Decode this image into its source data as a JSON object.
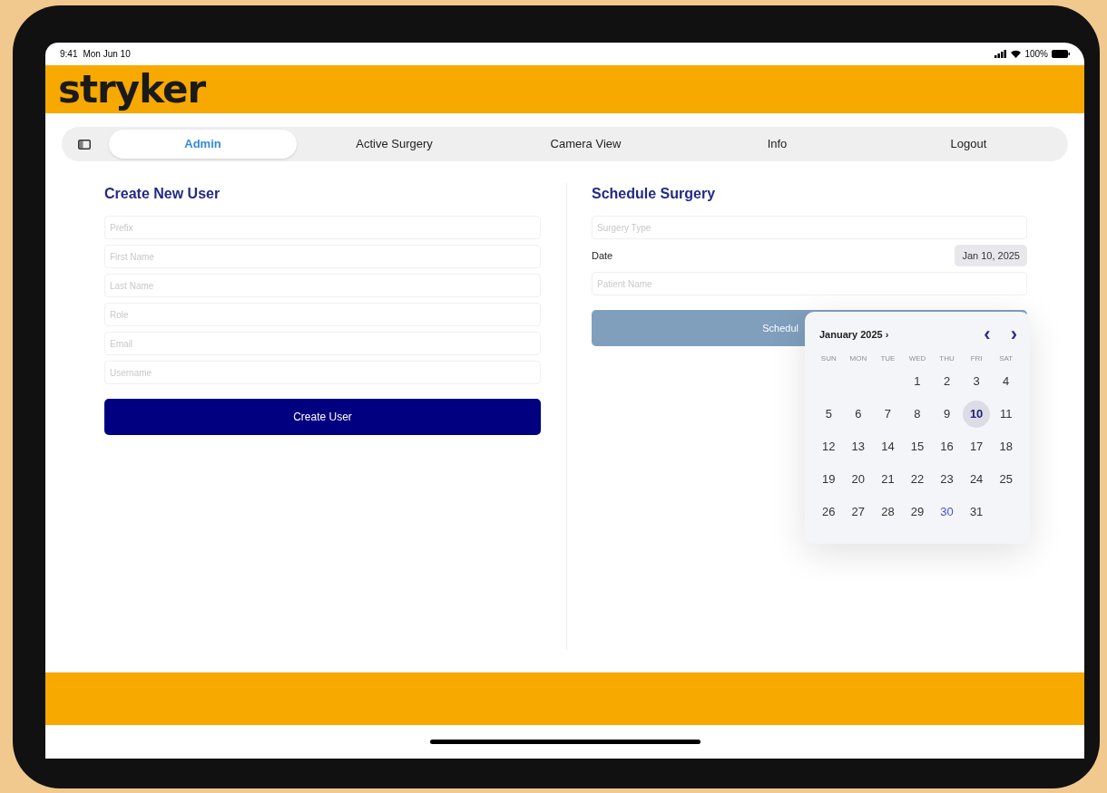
{
  "status_bar": {
    "time": "9:41",
    "date": "Mon Jun 10",
    "battery": "100%"
  },
  "header": {
    "logo": "stryker"
  },
  "tabs": [
    {
      "label": "Admin",
      "selected": true
    },
    {
      "label": "Active Surgery",
      "selected": false
    },
    {
      "label": "Camera View",
      "selected": false
    },
    {
      "label": "Info",
      "selected": false
    },
    {
      "label": "Logout",
      "selected": false
    }
  ],
  "create_user": {
    "title": "Create New User",
    "fields": [
      {
        "placeholder": "Prefix"
      },
      {
        "placeholder": "First Name"
      },
      {
        "placeholder": "Last Name"
      },
      {
        "placeholder": "Role"
      },
      {
        "placeholder": "Email"
      },
      {
        "placeholder": "Username"
      }
    ],
    "button": "Create User"
  },
  "schedule_surgery": {
    "title": "Schedule Surgery",
    "surgery_type": {
      "placeholder": "Surgery Type"
    },
    "date_label": "Date",
    "date_value": "Jan 10, 2025",
    "patient_name": {
      "placeholder": "Patient Name"
    },
    "button": "Schedul"
  },
  "date_picker": {
    "month": "January 2025",
    "month_caret": "›",
    "prev": "‹",
    "next": "›",
    "weekdays": [
      "SUN",
      "MON",
      "TUE",
      "WED",
      "THU",
      "FRI",
      "SAT"
    ],
    "days": [
      {
        "label": "1",
        "selected": false,
        "today": false
      },
      {
        "label": "2",
        "selected": false,
        "today": false
      },
      {
        "label": "3",
        "selected": false,
        "today": false
      },
      {
        "label": "4",
        "selected": false,
        "today": false
      },
      {
        "label": "5",
        "selected": false,
        "today": false
      },
      {
        "label": "6",
        "selected": false,
        "today": false
      },
      {
        "label": "7",
        "selected": false,
        "today": false
      },
      {
        "label": "8",
        "selected": false,
        "today": false
      },
      {
        "label": "9",
        "selected": false,
        "today": false
      },
      {
        "label": "10",
        "selected": true,
        "today": false
      },
      {
        "label": "11",
        "selected": false,
        "today": false
      },
      {
        "label": "12",
        "selected": false,
        "today": false
      },
      {
        "label": "13",
        "selected": false,
        "today": false
      },
      {
        "label": "14",
        "selected": false,
        "today": false
      },
      {
        "label": "15",
        "selected": false,
        "today": false
      },
      {
        "label": "16",
        "selected": false,
        "today": false
      },
      {
        "label": "17",
        "selected": false,
        "today": false
      },
      {
        "label": "18",
        "selected": false,
        "today": false
      },
      {
        "label": "19",
        "selected": false,
        "today": false
      },
      {
        "label": "20",
        "selected": false,
        "today": false
      },
      {
        "label": "21",
        "selected": false,
        "today": false
      },
      {
        "label": "22",
        "selected": false,
        "today": false
      },
      {
        "label": "23",
        "selected": false,
        "today": false
      },
      {
        "label": "24",
        "selected": false,
        "today": false
      },
      {
        "label": "25",
        "selected": false,
        "today": false
      },
      {
        "label": "26",
        "selected": false,
        "today": false
      },
      {
        "label": "27",
        "selected": false,
        "today": false
      },
      {
        "label": "28",
        "selected": false,
        "today": false
      },
      {
        "label": "29",
        "selected": false,
        "today": false
      },
      {
        "label": "30",
        "selected": false,
        "today": true
      },
      {
        "label": "31",
        "selected": false,
        "today": false
      }
    ]
  }
}
